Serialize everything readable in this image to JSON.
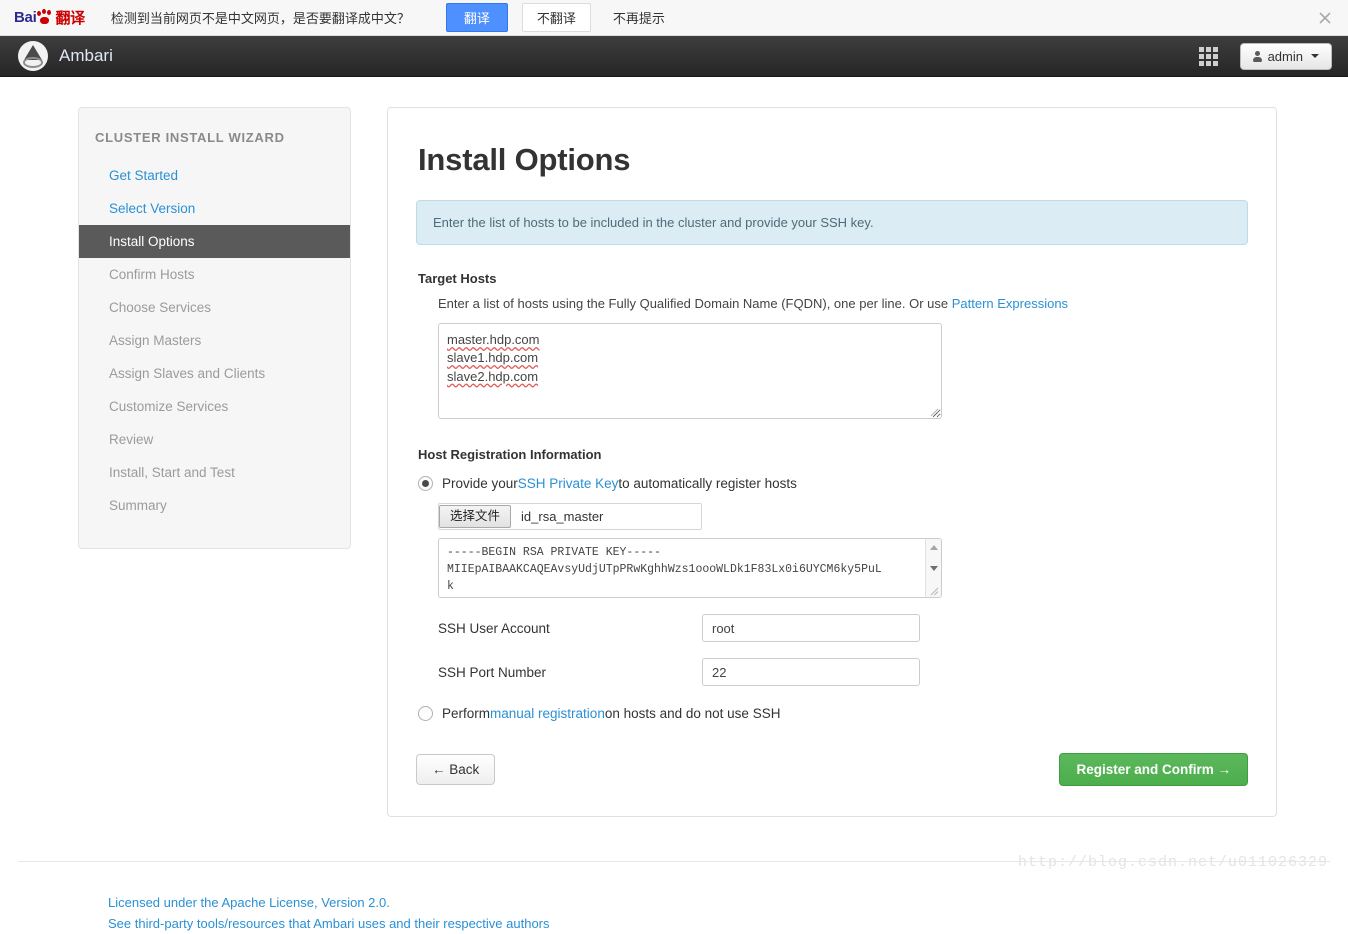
{
  "translate_bar": {
    "logo_bai": "Bai",
    "logo_fanyi": "翻译",
    "message": "检测到当前网页不是中文网页，是否要翻译成中文？",
    "translate_label": "翻译",
    "no_translate_label": "不翻译",
    "never_label": "不再提示",
    "close_icon": "close-icon",
    "accent_color": "#4d90fe"
  },
  "navbar": {
    "brand": "Ambari",
    "grid_icon": "apps-grid-icon",
    "user_icon": "user-icon",
    "user_label": "admin",
    "caret_icon": "chevron-down-icon"
  },
  "sidebar": {
    "title": "CLUSTER INSTALL WIZARD",
    "items": [
      {
        "label": "Get Started",
        "state": "done"
      },
      {
        "label": "Select Version",
        "state": "done"
      },
      {
        "label": "Install Options",
        "state": "active"
      },
      {
        "label": "Confirm Hosts",
        "state": "pending"
      },
      {
        "label": "Choose Services",
        "state": "pending"
      },
      {
        "label": "Assign Masters",
        "state": "pending"
      },
      {
        "label": "Assign Slaves and Clients",
        "state": "pending"
      },
      {
        "label": "Customize Services",
        "state": "pending"
      },
      {
        "label": "Review",
        "state": "pending"
      },
      {
        "label": "Install, Start and Test",
        "state": "pending"
      },
      {
        "label": "Summary",
        "state": "pending"
      }
    ],
    "active_bg": "#5a5a5a",
    "link_color": "#2a90d4"
  },
  "main": {
    "title": "Install Options",
    "alert": "Enter the list of hosts to be included in the cluster and provide your SSH key.",
    "target_hosts": {
      "heading": "Target Hosts",
      "helper_prefix": "Enter a list of hosts using the Fully Qualified Domain Name (FQDN), one per line. Or use ",
      "helper_link": "Pattern Expressions",
      "hosts": [
        "master.hdp.com",
        "slave1.hdp.com",
        "slave2.hdp.com"
      ],
      "placeholder": ""
    },
    "host_registration": {
      "heading": "Host Registration Information",
      "option_ssh": {
        "selected": true,
        "text_before": "Provide your ",
        "link": "SSH Private Key",
        "text_after": " to automatically register hosts"
      },
      "file_picker": {
        "button_label": "选择文件",
        "file_name": "id_rsa_master"
      },
      "private_key_text": "-----BEGIN RSA PRIVATE KEY-----\nMIIEpAIBAAKCAQEAvsyUdjUTpPRwKghhWzs1oooWLDk1F83Lx0i6UYCM6ky5PuL\nk",
      "ssh_user_label": "SSH User Account",
      "ssh_user_value": "root",
      "ssh_port_label": "SSH Port Number",
      "ssh_port_value": "22",
      "option_manual": {
        "selected": false,
        "text_before": "Perform ",
        "link": "manual registration",
        "text_after": " on hosts and do not use SSH"
      }
    },
    "buttons": {
      "back": "← Back",
      "register": "Register and Confirm →",
      "register_color": "#5cb85c"
    }
  },
  "footer": {
    "line1": "Licensed under the Apache License, Version 2.0.",
    "line2": "See third-party tools/resources that Ambari uses and their respective authors",
    "link_color": "#2a90d4"
  },
  "watermark": "http://blog.csdn.net/u011026329"
}
